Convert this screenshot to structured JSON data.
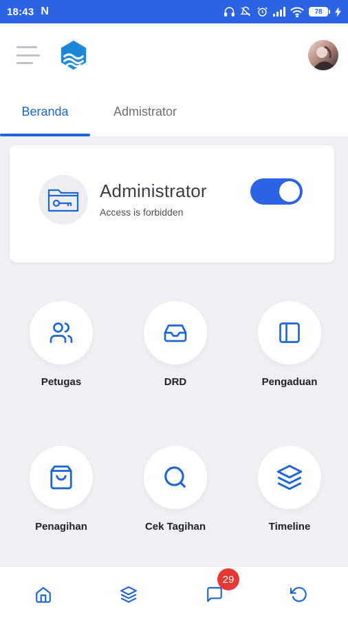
{
  "status_bar": {
    "time": "18:43",
    "notification_letter": "N",
    "battery_level": "78",
    "icons": [
      "headphones-icon",
      "mute-icon",
      "alarm-icon",
      "signal-icon",
      "wifi-icon",
      "battery-icon",
      "charging-icon"
    ]
  },
  "app_bar": {
    "icons": [
      "menu-icon",
      "app-logo",
      "avatar"
    ]
  },
  "tabs": [
    {
      "label": "Beranda",
      "active": true
    },
    {
      "label": "Admistrator",
      "active": false
    }
  ],
  "admin_card": {
    "title": "Administrator",
    "subtitle": "Access is forbidden",
    "toggle_on": true,
    "icon": "folder-key-icon"
  },
  "menu": [
    {
      "label": "Petugas",
      "icon": "users-icon"
    },
    {
      "label": "DRD",
      "icon": "inbox-icon"
    },
    {
      "label": "Pengaduan",
      "icon": "sidebar-icon"
    },
    {
      "label": "Penagihan",
      "icon": "shopping-bag-icon"
    },
    {
      "label": "Cek Tagihan",
      "icon": "search-icon"
    },
    {
      "label": "Timeline",
      "icon": "layers-icon"
    }
  ],
  "bottom_nav": {
    "items": [
      "home-icon",
      "layers-icon",
      "chat-icon",
      "refresh-icon"
    ],
    "chat_badge": "29"
  },
  "colors": {
    "primary": "#2a63e5",
    "tab_active": "#1e65d6",
    "background": "#eef0f4",
    "badge": "#e53935"
  }
}
